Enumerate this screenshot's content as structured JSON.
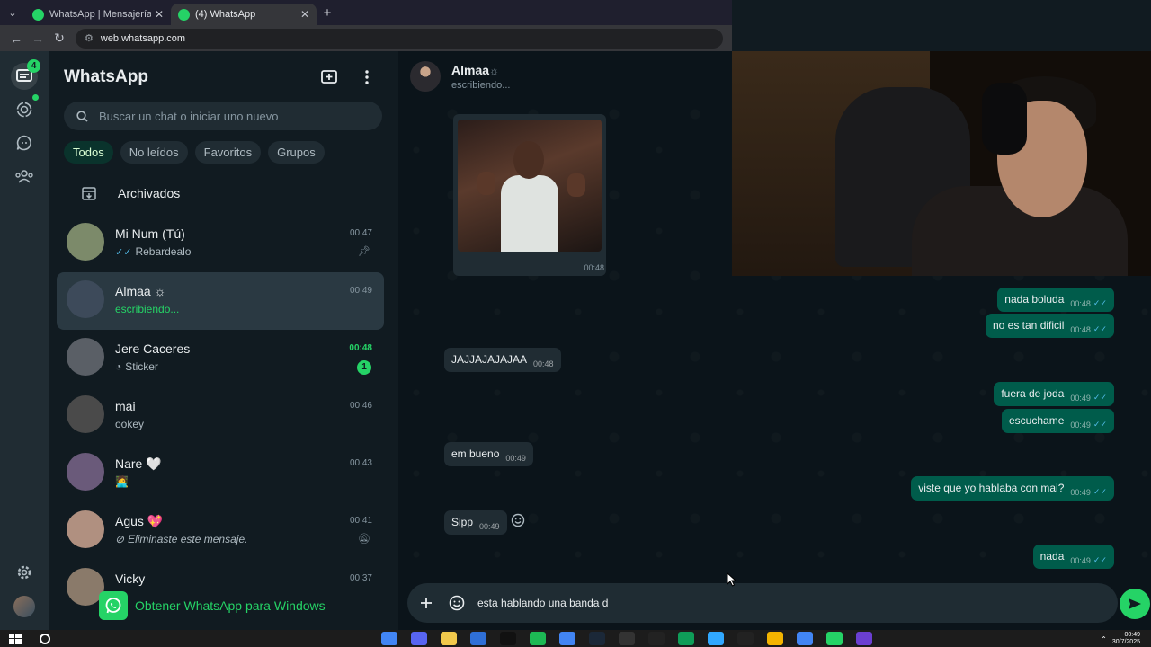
{
  "browser": {
    "tabs": [
      {
        "title": "WhatsApp | Mensajería y llamadas gratuitas",
        "active": false
      },
      {
        "title": "(4) WhatsApp",
        "active": true
      }
    ],
    "url": "web.whatsapp.com"
  },
  "rail": {
    "chats_badge": "4"
  },
  "sidebar": {
    "title": "WhatsApp",
    "search_placeholder": "Buscar un chat o iniciar uno nuevo",
    "filters": [
      "Todos",
      "No leídos",
      "Favoritos",
      "Grupos"
    ],
    "active_filter": "Todos",
    "archived_label": "Archivados",
    "get_app_label": "Obtener WhatsApp para Windows"
  },
  "chats": [
    {
      "name": "Mi Num (Tú)",
      "time": "00:47",
      "preview": "Rebardealo",
      "ticks": "✓✓",
      "meta_icon": "pin-icon",
      "avatar_color": "#7c8a6a"
    },
    {
      "name": "Almaa",
      "name_emoji": "☼",
      "time": "00:49",
      "preview": "escribiendo...",
      "typing": true,
      "active": true,
      "avatar_color": "#3d4a5a"
    },
    {
      "name": "Jere Caceres",
      "time": "00:48",
      "preview": "Sticker",
      "preview_icon": "sticker-icon",
      "unread": "1",
      "avatar_color": "#5a5f66"
    },
    {
      "name": "mai",
      "time": "00:46",
      "preview": "ookey",
      "avatar_color": "#4a4a4a"
    },
    {
      "name": "Nare",
      "name_emoji": "🤍",
      "time": "00:43",
      "preview": "🧑‍💻",
      "avatar_color": "#6a5a7a"
    },
    {
      "name": "Agus",
      "name_emoji": "💖",
      "time": "00:41",
      "preview": "Eliminaste este mensaje.",
      "preview_icon": "blocked-icon",
      "deleted": true,
      "meta_icon": "muted-icon",
      "avatar_color": "#b09080"
    },
    {
      "name": "Vicky",
      "time": "00:37",
      "preview": "",
      "avatar_color": "#8a7a6a"
    }
  ],
  "conversation": {
    "contact_name": "Almaa",
    "contact_emoji": "☼",
    "status": "escribiendo...",
    "image_time": "00:48",
    "messages": [
      {
        "dir": "out",
        "text": "nada boluda",
        "time": "00:48"
      },
      {
        "dir": "out",
        "text": "no es tan dificil",
        "time": "00:48"
      },
      {
        "dir": "in",
        "text": "JAJJAJAJAJAA",
        "time": "00:48"
      },
      {
        "dir": "out",
        "text": "fuera de joda",
        "time": "00:49"
      },
      {
        "dir": "out",
        "text": "escuchame",
        "time": "00:49"
      },
      {
        "dir": "in",
        "text": "em bueno",
        "time": "00:49"
      },
      {
        "dir": "out",
        "text": "viste que yo hablaba con mai?",
        "time": "00:49"
      },
      {
        "dir": "in",
        "text": "Sipp",
        "time": "00:49"
      },
      {
        "dir": "out",
        "text": "nada",
        "time": "00:49"
      }
    ],
    "composer_text": "esta hablando una banda d"
  },
  "taskbar": {
    "time": "00:49",
    "date": "30/7/2025"
  },
  "colors": {
    "accent": "#25d366",
    "outgoing_bubble": "#005c4b",
    "incoming_bubble": "#202c33",
    "read_ticks": "#53bdeb"
  }
}
